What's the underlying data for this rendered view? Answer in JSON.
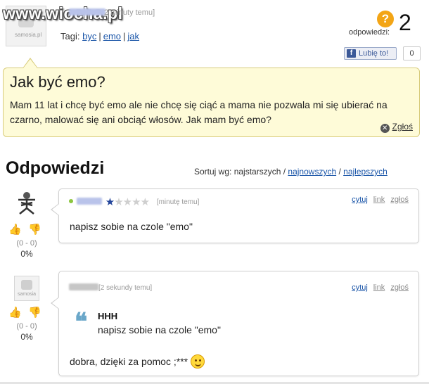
{
  "watermark": "www.wiocha.pl",
  "question": {
    "avatar_text": "samosia.pl",
    "time": "2 minuty temu]",
    "tags_label": "Tagi:",
    "tags": [
      "byc",
      "emo",
      "jak"
    ],
    "answers_label": "odpowiedzi:",
    "answers_count": "2",
    "like_label": "Lubię to!",
    "like_count": "0",
    "title": "Jak być emo?",
    "body": "Mam 11 lat i chcę być emo ale nie chcę się ciąć a mama nie pozwala mi się ubierać na czarno, malować się ani obciąć włosów. Jak mam być emo?",
    "report_label": "Zgłoś"
  },
  "answers_header": {
    "title": "Odpowiedzi",
    "sort_label": "Sortuj wg:",
    "sort_options": [
      "najstarszych",
      "najnowszych",
      "najlepszych"
    ]
  },
  "answers": [
    {
      "time": "[minutę temu]",
      "rating_stars": 1,
      "rating_max": 5,
      "actions": [
        "cytuj",
        "link",
        "zgłoś"
      ],
      "vote_count": "(0 - 0)",
      "vote_pct": "0%",
      "text": "napisz sobie na czole \"emo\""
    },
    {
      "avatar_text": "samosia",
      "time": "[2 sekundy temu]",
      "actions": [
        "cytuj",
        "link",
        "zgłoś"
      ],
      "vote_count": "(0 - 0)",
      "vote_pct": "0%",
      "quote_author": "HHH",
      "quote_text": "napisz sobie na czole \"emo\"",
      "text": "dobra, dzięki za pomoc ;***"
    }
  ],
  "colors": {
    "bubble_bg": "#fefbd8",
    "link": "#1a55a8",
    "accent_orange": "#f3a516",
    "star": "#23459a"
  },
  "icons": {
    "answers_badge": "question-mark-icon",
    "like": "facebook-icon",
    "report": "close-circle-icon",
    "vote_up": "thumbs-up-icon",
    "vote_down": "thumbs-down-icon",
    "quote": "quote-icon",
    "emoticon": "smiley-icon"
  }
}
